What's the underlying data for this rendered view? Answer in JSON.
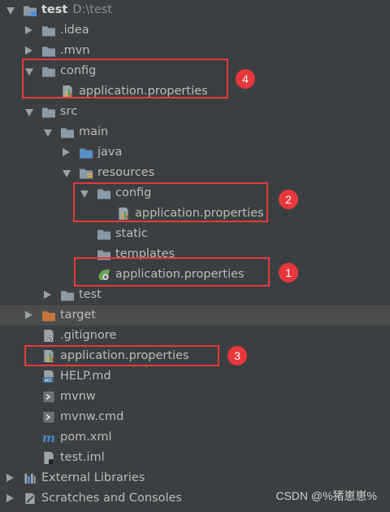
{
  "tree": {
    "root": {
      "label": "test",
      "path": "D:\\test"
    },
    "idea": ".idea",
    "mvn": ".mvn",
    "config": "config",
    "config_props": "application.properties",
    "src": "src",
    "main": "main",
    "java": "java",
    "resources": "resources",
    "res_config": "config",
    "res_config_props": "application.properties",
    "static": "static",
    "templates": "templates",
    "res_props": "application.properties",
    "test": "test",
    "target": "target",
    "gitignore": ".gitignore",
    "root_props": "application.properties",
    "help": "HELP.md",
    "mvnw": "mvnw",
    "mvnwcmd": "mvnw.cmd",
    "pom": "pom.xml",
    "iml": "test.iml",
    "ext_libs": "External Libraries",
    "scratches": "Scratches and Consoles"
  },
  "icon_labels": {
    "md": "MD",
    "pom": "m"
  },
  "annotations": [
    "1",
    "2",
    "3",
    "4"
  ],
  "watermark": "CSDN @%猪崽崽%",
  "colors": {
    "background": "#3c3f41",
    "highlight": "#4b4d4d",
    "folder": "#8a9aa6",
    "excluded_folder": "#c6763b",
    "source_folder": "#5a8fc4",
    "annotation": "#e8383d"
  }
}
